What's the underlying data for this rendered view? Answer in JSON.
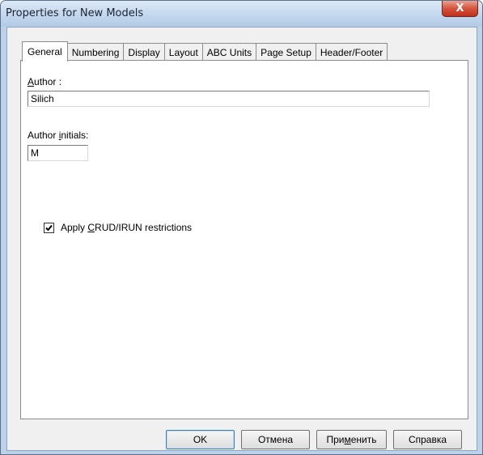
{
  "window": {
    "title": "Properties for New Models",
    "close_glyph": "X"
  },
  "tabs": [
    {
      "label": "General",
      "active": true
    },
    {
      "label": "Numbering",
      "active": false
    },
    {
      "label": "Display",
      "active": false
    },
    {
      "label": "Layout",
      "active": false
    },
    {
      "label": "ABC Units",
      "active": false
    },
    {
      "label": "Page Setup",
      "active": false
    },
    {
      "label": "Header/Footer",
      "active": false
    }
  ],
  "general": {
    "author_label_mnemonic": "A",
    "author_label_rest": "uthor :",
    "author_value": "Silich",
    "initials_label_pre": "Author ",
    "initials_label_mnemonic": "i",
    "initials_label_rest": "nitials:",
    "initials_value": "M",
    "crud_checked": true,
    "crud_label_pre": "Apply ",
    "crud_label_mnemonic": "C",
    "crud_label_rest": "RUD/IRUN restrictions"
  },
  "buttons": {
    "ok": "OK",
    "cancel": "Отмена",
    "apply_pre": "При",
    "apply_mnemonic": "м",
    "apply_rest": "енить",
    "help": "Справка"
  },
  "colors": {
    "title_frame": "#bcd2ea",
    "close_button": "#c0301c",
    "dialog_face": "#f0f0f0"
  }
}
